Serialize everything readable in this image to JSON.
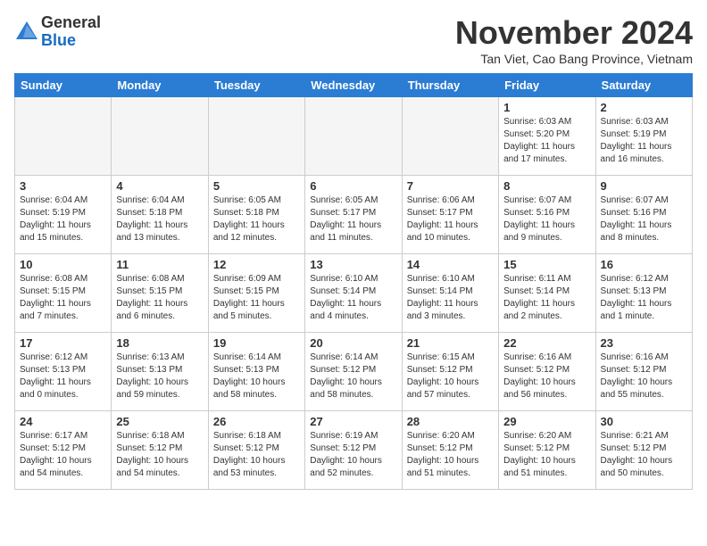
{
  "header": {
    "logo": {
      "general": "General",
      "blue": "Blue"
    },
    "month": "November 2024",
    "location": "Tan Viet, Cao Bang Province, Vietnam"
  },
  "weekdays": [
    "Sunday",
    "Monday",
    "Tuesday",
    "Wednesday",
    "Thursday",
    "Friday",
    "Saturday"
  ],
  "weeks": [
    [
      {
        "day": "",
        "empty": true
      },
      {
        "day": "",
        "empty": true
      },
      {
        "day": "",
        "empty": true
      },
      {
        "day": "",
        "empty": true
      },
      {
        "day": "",
        "empty": true
      },
      {
        "day": "1",
        "sunrise": "6:03 AM",
        "sunset": "5:20 PM",
        "daylight": "11 hours and 17 minutes."
      },
      {
        "day": "2",
        "sunrise": "6:03 AM",
        "sunset": "5:19 PM",
        "daylight": "11 hours and 16 minutes."
      }
    ],
    [
      {
        "day": "3",
        "sunrise": "6:04 AM",
        "sunset": "5:19 PM",
        "daylight": "11 hours and 15 minutes."
      },
      {
        "day": "4",
        "sunrise": "6:04 AM",
        "sunset": "5:18 PM",
        "daylight": "11 hours and 13 minutes."
      },
      {
        "day": "5",
        "sunrise": "6:05 AM",
        "sunset": "5:18 PM",
        "daylight": "11 hours and 12 minutes."
      },
      {
        "day": "6",
        "sunrise": "6:05 AM",
        "sunset": "5:17 PM",
        "daylight": "11 hours and 11 minutes."
      },
      {
        "day": "7",
        "sunrise": "6:06 AM",
        "sunset": "5:17 PM",
        "daylight": "11 hours and 10 minutes."
      },
      {
        "day": "8",
        "sunrise": "6:07 AM",
        "sunset": "5:16 PM",
        "daylight": "11 hours and 9 minutes."
      },
      {
        "day": "9",
        "sunrise": "6:07 AM",
        "sunset": "5:16 PM",
        "daylight": "11 hours and 8 minutes."
      }
    ],
    [
      {
        "day": "10",
        "sunrise": "6:08 AM",
        "sunset": "5:15 PM",
        "daylight": "11 hours and 7 minutes."
      },
      {
        "day": "11",
        "sunrise": "6:08 AM",
        "sunset": "5:15 PM",
        "daylight": "11 hours and 6 minutes."
      },
      {
        "day": "12",
        "sunrise": "6:09 AM",
        "sunset": "5:15 PM",
        "daylight": "11 hours and 5 minutes."
      },
      {
        "day": "13",
        "sunrise": "6:10 AM",
        "sunset": "5:14 PM",
        "daylight": "11 hours and 4 minutes."
      },
      {
        "day": "14",
        "sunrise": "6:10 AM",
        "sunset": "5:14 PM",
        "daylight": "11 hours and 3 minutes."
      },
      {
        "day": "15",
        "sunrise": "6:11 AM",
        "sunset": "5:14 PM",
        "daylight": "11 hours and 2 minutes."
      },
      {
        "day": "16",
        "sunrise": "6:12 AM",
        "sunset": "5:13 PM",
        "daylight": "11 hours and 1 minute."
      }
    ],
    [
      {
        "day": "17",
        "sunrise": "6:12 AM",
        "sunset": "5:13 PM",
        "daylight": "11 hours and 0 minutes."
      },
      {
        "day": "18",
        "sunrise": "6:13 AM",
        "sunset": "5:13 PM",
        "daylight": "10 hours and 59 minutes."
      },
      {
        "day": "19",
        "sunrise": "6:14 AM",
        "sunset": "5:13 PM",
        "daylight": "10 hours and 58 minutes."
      },
      {
        "day": "20",
        "sunrise": "6:14 AM",
        "sunset": "5:12 PM",
        "daylight": "10 hours and 58 minutes."
      },
      {
        "day": "21",
        "sunrise": "6:15 AM",
        "sunset": "5:12 PM",
        "daylight": "10 hours and 57 minutes."
      },
      {
        "day": "22",
        "sunrise": "6:16 AM",
        "sunset": "5:12 PM",
        "daylight": "10 hours and 56 minutes."
      },
      {
        "day": "23",
        "sunrise": "6:16 AM",
        "sunset": "5:12 PM",
        "daylight": "10 hours and 55 minutes."
      }
    ],
    [
      {
        "day": "24",
        "sunrise": "6:17 AM",
        "sunset": "5:12 PM",
        "daylight": "10 hours and 54 minutes."
      },
      {
        "day": "25",
        "sunrise": "6:18 AM",
        "sunset": "5:12 PM",
        "daylight": "10 hours and 54 minutes."
      },
      {
        "day": "26",
        "sunrise": "6:18 AM",
        "sunset": "5:12 PM",
        "daylight": "10 hours and 53 minutes."
      },
      {
        "day": "27",
        "sunrise": "6:19 AM",
        "sunset": "5:12 PM",
        "daylight": "10 hours and 52 minutes."
      },
      {
        "day": "28",
        "sunrise": "6:20 AM",
        "sunset": "5:12 PM",
        "daylight": "10 hours and 51 minutes."
      },
      {
        "day": "29",
        "sunrise": "6:20 AM",
        "sunset": "5:12 PM",
        "daylight": "10 hours and 51 minutes."
      },
      {
        "day": "30",
        "sunrise": "6:21 AM",
        "sunset": "5:12 PM",
        "daylight": "10 hours and 50 minutes."
      }
    ]
  ]
}
